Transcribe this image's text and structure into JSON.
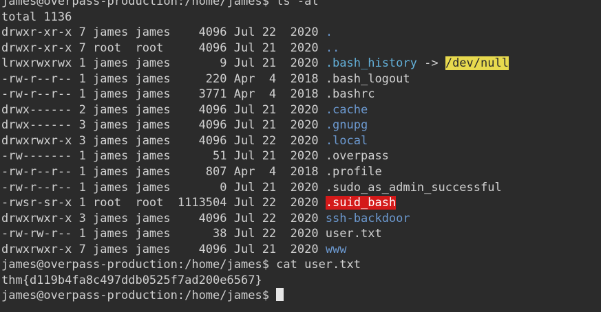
{
  "colors": {
    "background": "#2b2b2b",
    "foreground": "#d0d0d0",
    "directory": "#6c99d0",
    "symlink": "#63b0d9",
    "link_target_bg": "#e7d94e",
    "suid_bg": "#d41a1a"
  },
  "lines": [
    {
      "segments": [
        {
          "text": "james@overpass-production:/home/james$ ls -al",
          "style": "normal"
        }
      ]
    },
    {
      "segments": [
        {
          "text": "total 1136",
          "style": "normal"
        }
      ]
    },
    {
      "segments": [
        {
          "text": "drwxr-xr-x 7 james james    4096 Jul 22  2020 ",
          "style": "normal"
        },
        {
          "text": ".",
          "style": "dir"
        }
      ]
    },
    {
      "segments": [
        {
          "text": "drwxr-xr-x 7 root  root     4096 Jul 21  2020 ",
          "style": "normal"
        },
        {
          "text": "..",
          "style": "dir"
        }
      ]
    },
    {
      "segments": [
        {
          "text": "lrwxrwxrwx 1 james james       9 Jul 21  2020 ",
          "style": "normal"
        },
        {
          "text": ".bash_history",
          "style": "link"
        },
        {
          "text": " -> ",
          "style": "arrow"
        },
        {
          "text": "/dev/null",
          "style": "target"
        }
      ]
    },
    {
      "segments": [
        {
          "text": "-rw-r--r-- 1 james james     220 Apr  4  2018 .bash_logout",
          "style": "normal"
        }
      ]
    },
    {
      "segments": [
        {
          "text": "-rw-r--r-- 1 james james    3771 Apr  4  2018 .bashrc",
          "style": "normal"
        }
      ]
    },
    {
      "segments": [
        {
          "text": "drwx------ 2 james james    4096 Jul 21  2020 ",
          "style": "normal"
        },
        {
          "text": ".cache",
          "style": "dir"
        }
      ]
    },
    {
      "segments": [
        {
          "text": "drwx------ 3 james james    4096 Jul 21  2020 ",
          "style": "normal"
        },
        {
          "text": ".gnupg",
          "style": "dir"
        }
      ]
    },
    {
      "segments": [
        {
          "text": "drwxrwxr-x 3 james james    4096 Jul 22  2020 ",
          "style": "normal"
        },
        {
          "text": ".local",
          "style": "dir"
        }
      ]
    },
    {
      "segments": [
        {
          "text": "-rw------- 1 james james      51 Jul 21  2020 .overpass",
          "style": "normal"
        }
      ]
    },
    {
      "segments": [
        {
          "text": "-rw-r--r-- 1 james james     807 Apr  4  2018 .profile",
          "style": "normal"
        }
      ]
    },
    {
      "segments": [
        {
          "text": "-rw-r--r-- 1 james james       0 Jul 21  2020 .sudo_as_admin_successful",
          "style": "normal"
        }
      ]
    },
    {
      "segments": [
        {
          "text": "-rwsr-sr-x 1 root  root  1113504 Jul 22  2020 ",
          "style": "normal"
        },
        {
          "text": ".suid_bash",
          "style": "suid"
        }
      ]
    },
    {
      "segments": [
        {
          "text": "drwxrwxr-x 3 james james    4096 Jul 22  2020 ",
          "style": "normal"
        },
        {
          "text": "ssh-backdoor",
          "style": "dir"
        }
      ]
    },
    {
      "segments": [
        {
          "text": "-rw-rw-r-- 1 james james      38 Jul 22  2020 user.txt",
          "style": "normal"
        }
      ]
    },
    {
      "segments": [
        {
          "text": "drwxrwxr-x 7 james james    4096 Jul 21  2020 ",
          "style": "normal"
        },
        {
          "text": "www",
          "style": "dir"
        }
      ]
    },
    {
      "segments": [
        {
          "text": "james@overpass-production:/home/james$ cat user.txt",
          "style": "normal"
        }
      ]
    },
    {
      "segments": [
        {
          "text": "thm{d119b4fa8c497ddb0525f7ad200e6567}",
          "style": "normal"
        }
      ]
    },
    {
      "segments": [
        {
          "text": "james@overpass-production:/home/james$ ",
          "style": "normal"
        }
      ],
      "cursor": true
    }
  ]
}
